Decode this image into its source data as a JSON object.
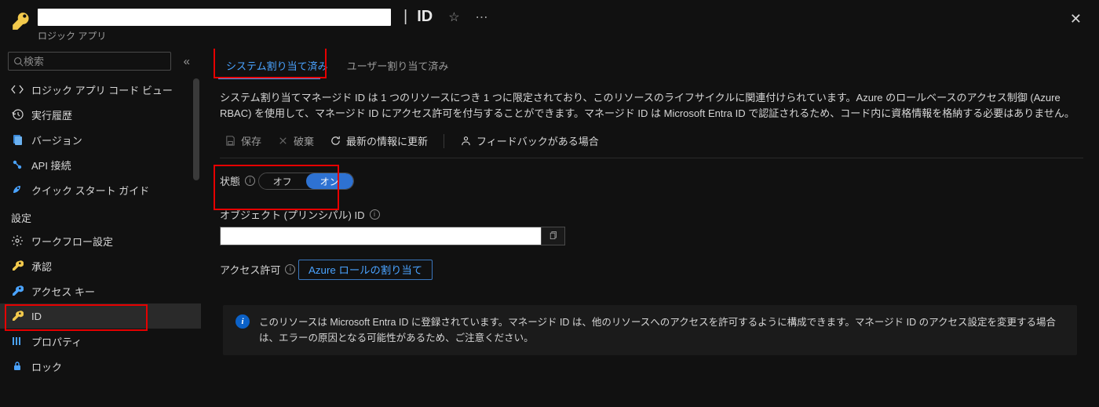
{
  "header": {
    "title_suffix": "ID",
    "subtitle": "ロジック アプリ"
  },
  "search": {
    "placeholder": "検索"
  },
  "sidebar": {
    "items": [
      {
        "icon": "code",
        "label": "ロジック アプリ コード ビュー"
      },
      {
        "icon": "history",
        "label": "実行履歴"
      },
      {
        "icon": "versions",
        "label": "バージョン"
      },
      {
        "icon": "api",
        "label": "API 接続"
      },
      {
        "icon": "quickstart",
        "label": "クイック スタート ガイド"
      }
    ],
    "section_label": "設定",
    "settings_items": [
      {
        "icon": "gear",
        "label": "ワークフロー設定"
      },
      {
        "icon": "key-yellow",
        "label": "承認"
      },
      {
        "icon": "keys",
        "label": "アクセス キー"
      },
      {
        "icon": "id",
        "label": "ID"
      },
      {
        "icon": "props",
        "label": "プロパティ"
      },
      {
        "icon": "lock",
        "label": "ロック"
      }
    ]
  },
  "tabs": {
    "system": "システム割り当て済み",
    "user": "ユーザー割り当て済み"
  },
  "description": "システム割り当てマネージド ID は 1 つのリソースにつき 1 つに限定されており、このリソースのライフサイクルに関連付けられています。Azure のロールベースのアクセス制御 (Azure RBAC) を使用して、マネージド ID にアクセス許可を付与することができます。マネージド ID は Microsoft Entra ID で認証されるため、コード内に資格情報を格納する必要はありません。",
  "toolbar": {
    "save": "保存",
    "discard": "破棄",
    "refresh": "最新の情報に更新",
    "feedback": "フィードバックがある場合"
  },
  "form": {
    "status_label": "状態",
    "status_off": "オフ",
    "status_on": "オン",
    "object_id_label": "オブジェクト (プリンシパル) ID",
    "object_id_value": "",
    "permissions_label": "アクセス許可",
    "permissions_button": "Azure ロールの割り当て"
  },
  "banner": {
    "text": "このリソースは Microsoft Entra ID に登録されています。マネージド ID は、他のリソースへのアクセスを許可するように構成できます。マネージド ID のアクセス設定を変更する場合は、エラーの原因となる可能性があるため、ご注意ください。"
  }
}
